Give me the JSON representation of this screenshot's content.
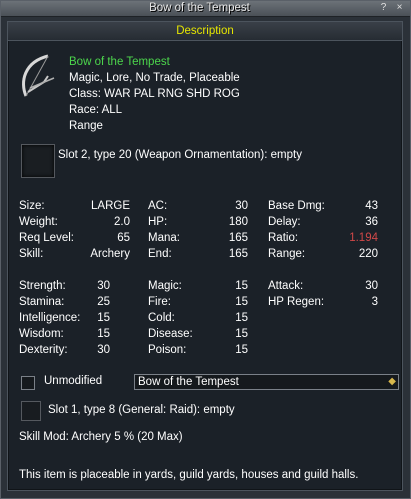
{
  "window": {
    "title": "Bow of the Tempest",
    "help_label": "?",
    "close_label": "×"
  },
  "header": {
    "label": "Description"
  },
  "item": {
    "name": "Bow of the Tempest",
    "flags": "Magic, Lore, No Trade, Placeable",
    "class": "Class: WAR PAL RNG SHD ROG",
    "race": "Race: ALL",
    "type": "Range"
  },
  "ornament_slot": {
    "text": "Slot 2, type 20 (Weapon Ornamentation): empty"
  },
  "stats_basic": {
    "col1": [
      {
        "label": "Size:",
        "value": "LARGE"
      },
      {
        "label": "Weight:",
        "value": "2.0"
      },
      {
        "label": "Req Level:",
        "value": "65"
      },
      {
        "label": "Skill:",
        "value": "Archery"
      }
    ],
    "col2": [
      {
        "label": "AC:",
        "value": "30"
      },
      {
        "label": "HP:",
        "value": "180"
      },
      {
        "label": "Mana:",
        "value": "165"
      },
      {
        "label": "End:",
        "value": "165"
      }
    ],
    "col3": [
      {
        "label": "Base Dmg:",
        "value": "43"
      },
      {
        "label": "Delay:",
        "value": "36"
      },
      {
        "label": "Ratio:",
        "value": "1.194"
      },
      {
        "label": "Range:",
        "value": "220"
      }
    ]
  },
  "stats_attr": {
    "col1": [
      {
        "label": "Strength:",
        "value": "30"
      },
      {
        "label": "Stamina:",
        "value": "25"
      },
      {
        "label": "Intelligence:",
        "value": "15"
      },
      {
        "label": "Wisdom:",
        "value": "15"
      },
      {
        "label": "Dexterity:",
        "value": "30"
      }
    ],
    "col2": [
      {
        "label": "Magic:",
        "value": "15"
      },
      {
        "label": "Fire:",
        "value": "15"
      },
      {
        "label": "Cold:",
        "value": "15"
      },
      {
        "label": "Disease:",
        "value": "15"
      },
      {
        "label": "Poison:",
        "value": "15"
      }
    ],
    "col3": [
      {
        "label": "Attack:",
        "value": "30"
      },
      {
        "label": "HP Regen:",
        "value": "3"
      }
    ]
  },
  "unmodified": {
    "label": "Unmodified"
  },
  "dropdown": {
    "selected": "Bow of the Tempest"
  },
  "raid_slot": {
    "text": "Slot 1, type 8 (General: Raid): empty"
  },
  "skill_mod": {
    "text": "Skill Mod: Archery 5 % (20 Max)"
  },
  "footer": {
    "text": "This item is placeable in yards, guild yards, houses and guild halls."
  },
  "colors": {
    "name": "#4cd64c",
    "ratio": "#d04848",
    "header_text": "#e6e600"
  }
}
